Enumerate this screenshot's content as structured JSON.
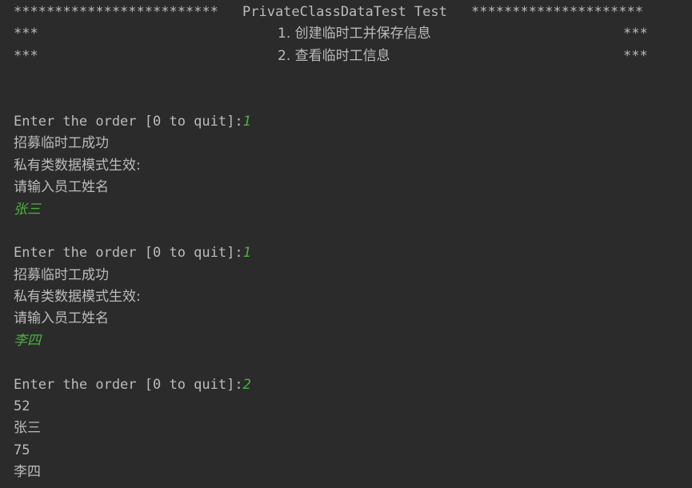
{
  "console": {
    "banner": {
      "stars_left": "*************************",
      "title": "PrivateClassDataTest Test",
      "stars_right": "*********************"
    },
    "menu": [
      {
        "prefix": "***",
        "item": "1. 创建临时工并保存信息",
        "suffix": "***"
      },
      {
        "prefix": "***",
        "item": "2. 查看临时工信息",
        "suffix": "***"
      }
    ],
    "sessions": [
      {
        "prompt": "Enter the order [0 to quit]:",
        "input": "1",
        "outputs": [
          "招募临时工成功",
          "私有类数据模式生效:",
          "请输入员工姓名"
        ],
        "name_input": "张三"
      },
      {
        "prompt": "Enter the order [0 to quit]:",
        "input": "1",
        "outputs": [
          "招募临时工成功",
          "私有类数据模式生效:",
          "请输入员工姓名"
        ],
        "name_input": "李四"
      },
      {
        "prompt": "Enter the order [0 to quit]:",
        "input": "2",
        "outputs": [
          "52",
          "张三",
          "75",
          "李四"
        ]
      }
    ],
    "colors": {
      "background": "#2b2b2b",
      "text": "#bbbbbb",
      "user_input": "#4cb13f"
    }
  }
}
